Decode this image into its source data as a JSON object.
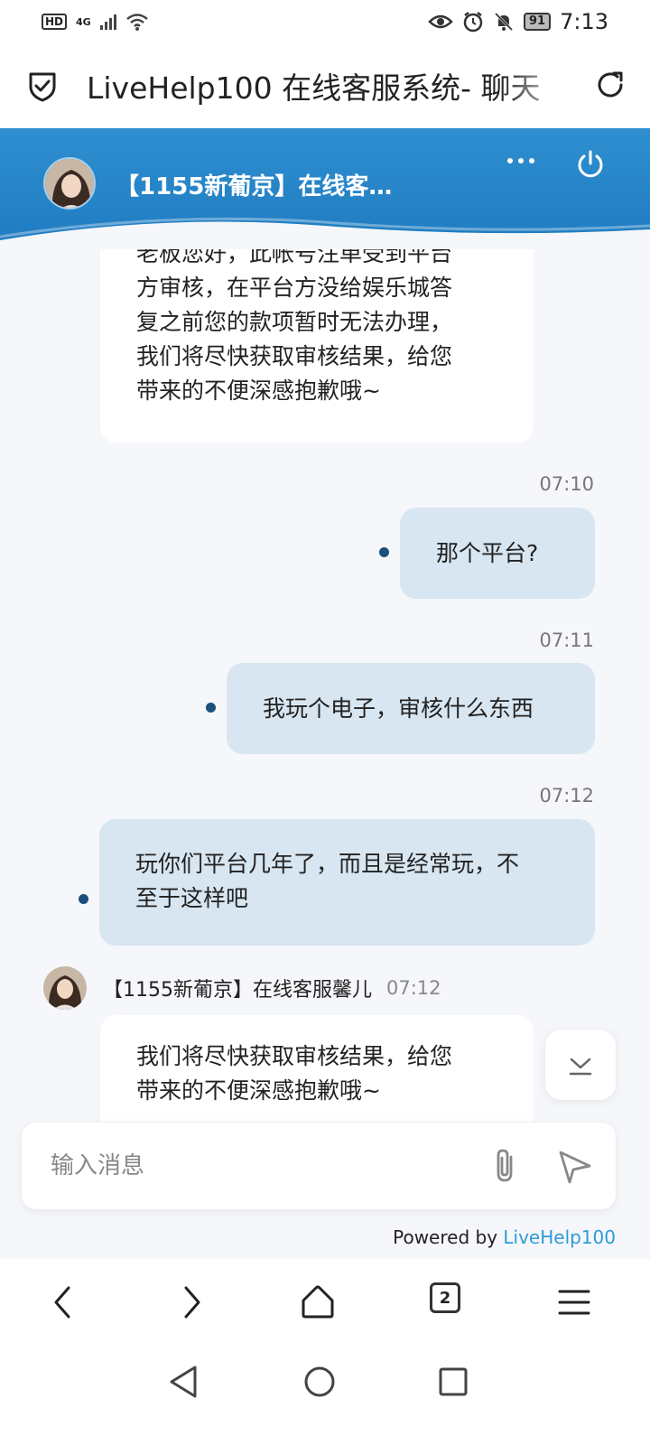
{
  "status_bar": {
    "hd_label": "HD",
    "network_label": "4G",
    "battery": "91",
    "time": "7:13"
  },
  "browser": {
    "page_title": "LiveHelp100 在线客服系统- 聊天",
    "tab_count": "2"
  },
  "chat_header": {
    "agent_name": "【1155新葡京】在线客服..."
  },
  "messages": [
    {
      "from": "agent",
      "text_lines": [
        "老板您好，此帐号注单受到平台",
        "方审核，在平台方没给娱乐城答",
        "复之前您的款项暂时无法办理，",
        "我们将尽快获取审核结果，给您",
        "带来的不便深感抱歉哦~"
      ]
    },
    {
      "from": "user",
      "time": "07:10",
      "text": "那个平台?"
    },
    {
      "from": "user",
      "time": "07:11",
      "text": "我玩个电子，审核什么东西"
    },
    {
      "from": "user",
      "time": "07:12",
      "text_lines": [
        "玩你们平台几年了，而且是经常玩，不",
        "至于这样吧"
      ]
    },
    {
      "from": "agent",
      "sender": "【1155新葡京】在线客服馨儿",
      "time": "07:12",
      "text_lines": [
        "我们将尽快获取审核结果，给您",
        "带来的不便深感抱歉哦~"
      ]
    }
  ],
  "input": {
    "placeholder": "输入消息"
  },
  "footer": {
    "powered_prefix": "Powered by ",
    "powered_brand": "LiveHelp100"
  },
  "colors": {
    "header_blue": "#2e8fd0",
    "user_bubble": "#d8e6f1",
    "sent_dot": "#1c4f7a",
    "brand_link": "#2e9bd6"
  },
  "icons": {
    "browser": [
      "shield-check-icon",
      "reload-icon"
    ],
    "header": [
      "more-icon",
      "power-icon"
    ],
    "input": [
      "paperclip-icon",
      "send-icon"
    ],
    "browser_nav": [
      "back-arrow-icon",
      "forward-arrow-icon",
      "home-icon",
      "tabs-icon",
      "menu-icon"
    ],
    "system_nav": [
      "triangle-back-icon",
      "circle-home-icon",
      "square-recents-icon"
    ]
  }
}
